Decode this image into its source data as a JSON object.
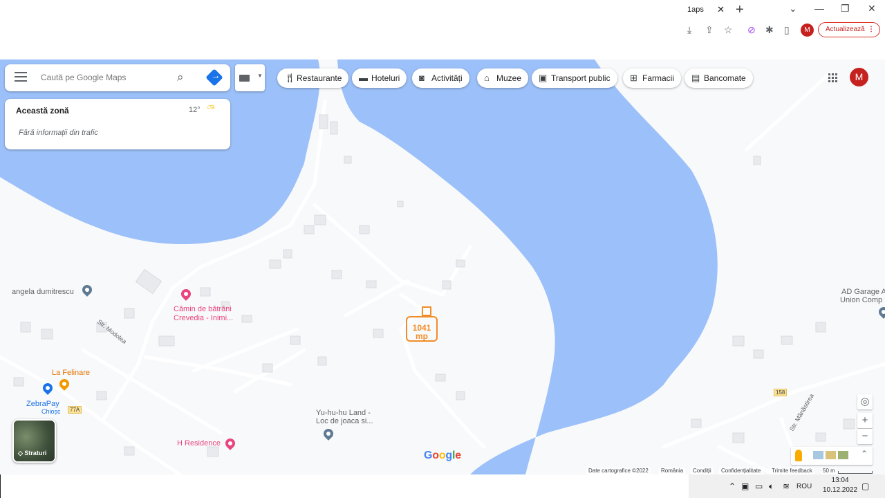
{
  "browser": {
    "tab_title": "1aps",
    "tab_close": "✕",
    "new_tab": "+",
    "update_button": "Actualizează",
    "profile_initial": "M",
    "window_controls": [
      "⌄",
      "—",
      "❐",
      "✕"
    ]
  },
  "search": {
    "placeholder": "Caută pe Google Maps"
  },
  "chips": [
    {
      "label": "Restaurante",
      "icon": "fork-knife-icon"
    },
    {
      "label": "Hoteluri",
      "icon": "bed-icon"
    },
    {
      "label": "Activități",
      "icon": "camera-icon"
    },
    {
      "label": "Muzee",
      "icon": "museum-icon"
    },
    {
      "label": "Transport public",
      "icon": "bus-icon"
    },
    {
      "label": "Farmacii",
      "icon": "pharmacy-icon"
    },
    {
      "label": "Bancomate",
      "icon": "atm-icon"
    }
  ],
  "account": {
    "initial": "M"
  },
  "info_card": {
    "title": "Această zonă",
    "temperature": "12°",
    "traffic": "Fără informații din trafic"
  },
  "map_labels": {
    "poi_angela": "angela dumitrescu",
    "street_modolea": "Str. Modolea",
    "camin_line1": "Cămin de bătrâni",
    "camin_line2": "Crevedia - Inimi...",
    "la_felinare": "La Felinare",
    "zebrapay": "ZebraPay",
    "zebrapay_sub": "Chioșc",
    "road_77a": "77A",
    "h_residence": "H Residence",
    "yuhuhu_line1": "Yu-hu-hu Land -",
    "yuhuhu_line2": "Loc de joaca si...",
    "ad_garage_line1": "AD Garage A",
    "ad_garage_line2": "Union Comp",
    "road_158": "158",
    "street_manastirea": "Str. Mănăstirea"
  },
  "measurement": {
    "line1": "1041",
    "line2": "mp"
  },
  "layers": {
    "label": "Straturi"
  },
  "google_logo": "Google",
  "map_controls": {
    "zoom_in": "+",
    "zoom_out": "−",
    "location": "◎",
    "expand": "⌃"
  },
  "attribution": {
    "data": "Date cartografice ©2022",
    "country": "România",
    "terms": "Condiții",
    "privacy": "Confidențialitate",
    "feedback": "Trimite feedback",
    "scale": "50 m"
  },
  "taskbar": {
    "language": "ROU",
    "time": "13:04",
    "date": "10.12.2022"
  },
  "colors": {
    "water": "#9cc0f9",
    "land": "#f8f9fa",
    "accent": "#1a73e8",
    "measure": "#f28c28",
    "poi_pink": "#e8467c",
    "poi_orange": "#f29900",
    "poi_blue": "#1a73e8"
  }
}
